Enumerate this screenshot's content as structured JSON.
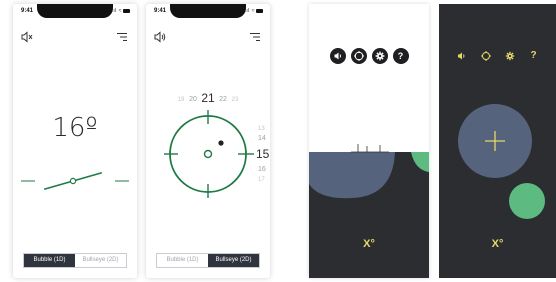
{
  "colors": {
    "accent_green": "#1f7a44",
    "dark_bg": "#2b2d31",
    "slate_blue": "#55637d",
    "mint": "#5dbb82",
    "yellow": "#e8d86a"
  },
  "screen1": {
    "status_time": "9:41",
    "status_icons": ".ııl ≈",
    "left_icon": "speaker-muted-icon",
    "right_icon": "menu-icon",
    "degree": "16º",
    "tilt_angle_deg": 16,
    "segment": {
      "bubble": "Bubble (1D)",
      "bullseye": "Bullseye (2D)",
      "active": "bubble"
    }
  },
  "screen2": {
    "status_time": "9:41",
    "status_icons": ".ııl ≈",
    "left_icon": "speaker-icon",
    "right_icon": "menu-icon",
    "x_ticks": [
      "19",
      "20",
      "21",
      "22",
      "23"
    ],
    "x_main": "21",
    "y_ticks": [
      "13",
      "14",
      "15",
      "16",
      "17"
    ],
    "y_main": "15",
    "segment": {
      "bubble": "Bubble (1D)",
      "bullseye": "Bullseye (2D)",
      "active": "bullseye"
    }
  },
  "screen3": {
    "toolbar": [
      "speaker-icon",
      "crosshair-icon",
      "gear-icon",
      "help-icon"
    ],
    "help_label": "?",
    "reading": "X°"
  },
  "screen4": {
    "toolbar": [
      "speaker-icon",
      "crosshair-icon",
      "gear-icon",
      "help-icon"
    ],
    "help_label": "?",
    "reading": "X°"
  }
}
